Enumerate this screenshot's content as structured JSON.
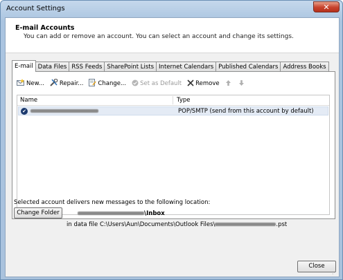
{
  "window": {
    "title": "Account Settings",
    "close_glyph": "✕"
  },
  "header": {
    "title": "E-mail Accounts",
    "subtitle": "You can add or remove an account. You can select an account and change its settings."
  },
  "tabs": [
    {
      "label": "E-mail",
      "active": true
    },
    {
      "label": "Data Files"
    },
    {
      "label": "RSS Feeds"
    },
    {
      "label": "SharePoint Lists"
    },
    {
      "label": "Internet Calendars"
    },
    {
      "label": "Published Calendars"
    },
    {
      "label": "Address Books"
    }
  ],
  "toolbar": {
    "new_label": "New...",
    "repair_label": "Repair...",
    "change_label": "Change...",
    "set_default_label": "Set as Default",
    "remove_label": "Remove"
  },
  "list": {
    "col_name": "Name",
    "col_type": "Type",
    "rows": [
      {
        "type": "POP/SMTP (send from this account by default)"
      }
    ]
  },
  "delivery": {
    "label": "Selected account delivers new messages to the following location:",
    "change_folder_label": "Change Folder",
    "folder_suffix": "\\Inbox",
    "datafile_prefix": "in data file C:\\Users\\Aun\\Documents\\Outlook Files\\",
    "datafile_suffix": ".pst"
  },
  "footer": {
    "close_label": "Close"
  },
  "colors": {
    "title_bar": "#aac4e0",
    "close_red": "#c7422c",
    "selection": "#e4ebf5"
  }
}
